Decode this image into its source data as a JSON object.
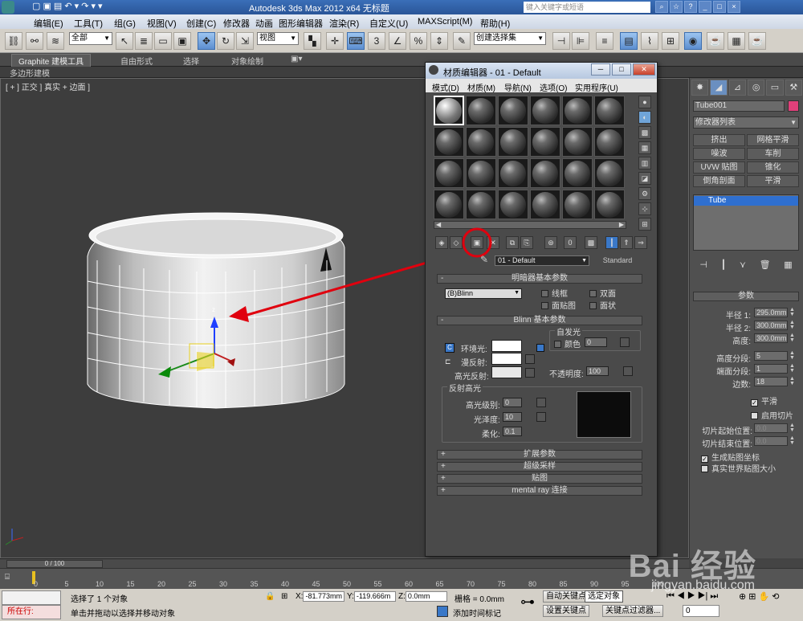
{
  "title_bar": {
    "title": "Autodesk 3ds Max  2012 x64       无标题",
    "search_placeholder": "键入关键字或短语"
  },
  "menu_bar": [
    "编辑(E)",
    "工具(T)",
    "组(G)",
    "视图(V)",
    "创建(C)",
    "修改器",
    "动画",
    "图形编辑器",
    "渲染(R)",
    "自定义(U)",
    "MAXScript(M)",
    "帮助(H)"
  ],
  "toolbar": {
    "selection_filter": "全部",
    "reference_coord": "视图",
    "named_selection": "创建选择集"
  },
  "ribbon": {
    "tabs": [
      "Graphite 建模工具",
      "自由形式",
      "选择",
      "对象绘制"
    ],
    "sub_label": "多边形建模"
  },
  "viewport": {
    "label": "[ + ] 正交 ] 真实 + 边面 ]",
    "axis_label": "z"
  },
  "material_editor": {
    "title": "材质编辑器 - 01 - Default",
    "menu": [
      "模式(D)",
      "材质(M)",
      "导航(N)",
      "选项(O)",
      "实用程序(U)"
    ],
    "material_name": "01 - Default",
    "material_type": "Standard",
    "shader_rollout": "明暗器基本参数",
    "shader_type": "(B)Blinn",
    "shader_checks": [
      "线框",
      "双面",
      "面贴图",
      "面状"
    ],
    "blinn_rollout": "Blinn 基本参数",
    "self_illum_group": "自发光",
    "color_label": "颜色",
    "self_illum_value": "0",
    "ambient_label": "环境光:",
    "diffuse_label": "漫反射:",
    "specular_label": "高光反射:",
    "opacity_label": "不透明度:",
    "opacity_value": "100",
    "spec_group": "反射高光",
    "spec_level_label": "高光级别:",
    "spec_level_value": "0",
    "gloss_label": "光泽度:",
    "gloss_value": "10",
    "soften_label": "柔化:",
    "soften_value": "0.1",
    "rollouts": [
      "扩展参数",
      "超级采样",
      "贴图",
      "mental ray 连接"
    ],
    "colors": {
      "ambient": "#ffffff",
      "diffuse": "#ffffff",
      "specular": "#e8e8e8"
    }
  },
  "command_panel": {
    "object_name": "Tube001",
    "object_color": "#e0407a",
    "modifier_list": "修改器列表",
    "modifier_buttons": [
      "挤出",
      "网格平滑",
      "噪波",
      "车削",
      "UVW 贴图",
      "锥化",
      "倒角剖面",
      "平滑"
    ],
    "stack_item": "Tube",
    "params_header": "参数",
    "params": [
      {
        "label": "半径 1:",
        "value": "295.0mm"
      },
      {
        "label": "半径 2:",
        "value": "300.0mm"
      },
      {
        "label": "高度:",
        "value": "300.0mm"
      },
      {
        "label": "高度分段:",
        "value": "5"
      },
      {
        "label": "端面分段:",
        "value": "1"
      },
      {
        "label": "边数:",
        "value": "18"
      }
    ],
    "smooth_label": "平滑",
    "slice_on_label": "启用切片",
    "slice_from_label": "切片起始位置:",
    "slice_from_value": "0.0",
    "slice_to_label": "切片结束位置:",
    "slice_to_value": "0.0",
    "gen_map_label": "生成贴图坐标",
    "real_world_label": "真实世界贴图大小"
  },
  "timeline": {
    "frame_label": "0 / 100",
    "ticks": [
      "0",
      "5",
      "10",
      "15",
      "20",
      "25",
      "30",
      "35",
      "40",
      "45",
      "50",
      "55",
      "60",
      "65",
      "70",
      "75",
      "80",
      "85",
      "90",
      "95",
      "100"
    ]
  },
  "status": {
    "maxscript_label": "所在行:",
    "selected_text": "选择了 1 个对象",
    "prompt_text": "单击并拖动以选择并移动对象",
    "x_label": "X:",
    "x_value": "-81.773mm",
    "y_label": "Y:",
    "y_value": "-119.666m",
    "z_label": "Z:",
    "z_value": "0.0mm",
    "grid_text": "栅格 = 0.0mm",
    "auto_key": "自动关键点",
    "selected_obj": "选定对象",
    "set_key": "设置关键点",
    "key_filter": "关键点过滤器...",
    "add_time_tag": "添加时间标记",
    "frame_value": "0"
  },
  "watermark": {
    "logo": "Bai 经验",
    "url": "jingyan.baidu.com"
  }
}
